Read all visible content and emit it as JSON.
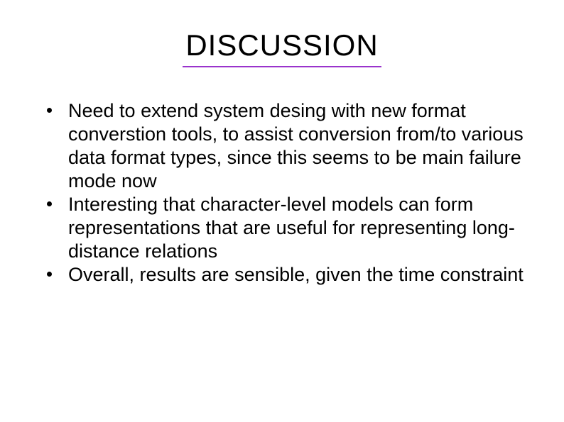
{
  "title": "DISCUSSION",
  "bullets": [
    "Need to extend system desing with new format converstion tools, to assist conversion from/to various data format types, since this seems to be main failure mode now",
    "Interesting that character-level models can form representations that are useful for representing long-distance relations",
    "Overall, results are sensible, given the time constraint"
  ]
}
